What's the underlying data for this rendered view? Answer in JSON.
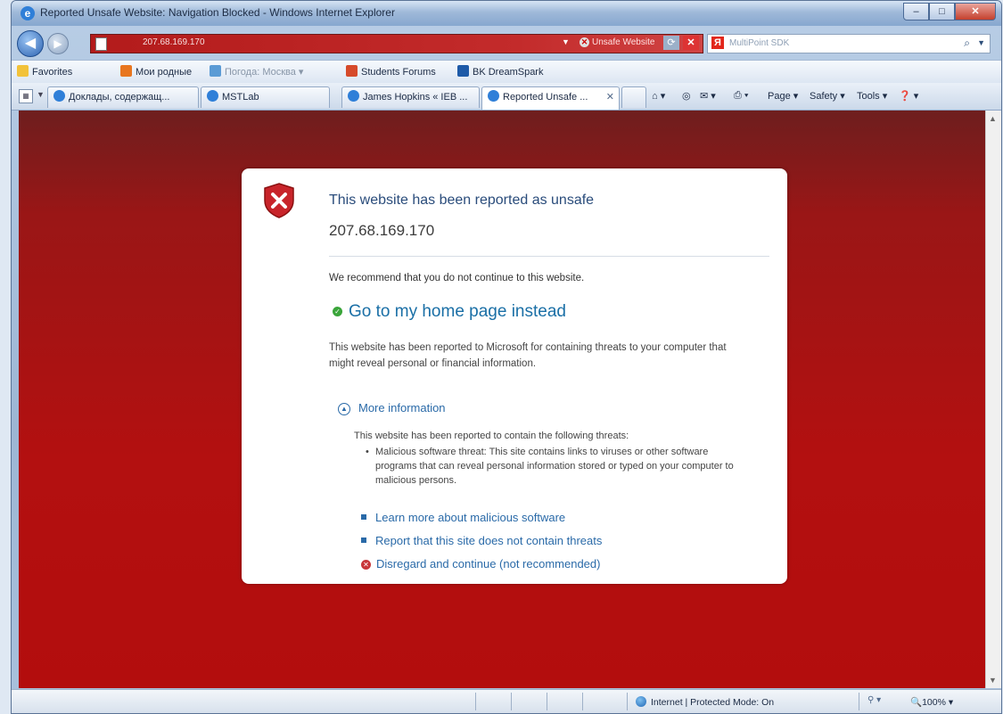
{
  "window": {
    "title": "Reported Unsafe Website: Navigation Blocked - Windows Internet Explorer",
    "min": "–",
    "max": "□",
    "close": "✕"
  },
  "address": {
    "url": "207.68.169.170",
    "status": "Unsafe Website",
    "refresh_icon": "refresh-icon",
    "stop_icon": "stop-icon"
  },
  "search": {
    "placeholder": "MultiPoint SDK",
    "engine": "Я"
  },
  "favorites": {
    "label": "Favorites",
    "items": [
      "Мои родные",
      "Погода: Москва",
      "Students Forums",
      "BK DreamSpark"
    ]
  },
  "tabs": [
    {
      "label": "Доклады, содержащ..."
    },
    {
      "label": "MSTLab"
    },
    {
      "label": "James Hopkins « IEB ..."
    },
    {
      "label": "Reported Unsafe ..."
    }
  ],
  "commands": {
    "page": "Page",
    "safety": "Safety",
    "tools": "Tools"
  },
  "page": {
    "heading": "This website has been reported as unsafe",
    "ip": "207.68.169.170",
    "recommend": "We recommend that you do not continue to this website.",
    "home_link": "Go to my home page instead",
    "description": "This website has been reported to Microsoft for containing threats to your computer that might reveal personal or financial information.",
    "more_info": "More information",
    "threats_intro": "This website has been reported to contain the following threats:",
    "threat_item": "Malicious software threat: This site contains links to viruses or other software programs that can reveal personal information stored or typed on your computer to malicious persons.",
    "link_learn": "Learn more about malicious software",
    "link_report": "Report that this site does not contain threats",
    "link_disregard": "Disregard and continue (not recommended)"
  },
  "status": {
    "zone": "Internet | Protected Mode: On",
    "zoom": "100%"
  },
  "colors": {
    "danger_red": "#b30d0d",
    "link_blue": "#2a6aa8"
  }
}
